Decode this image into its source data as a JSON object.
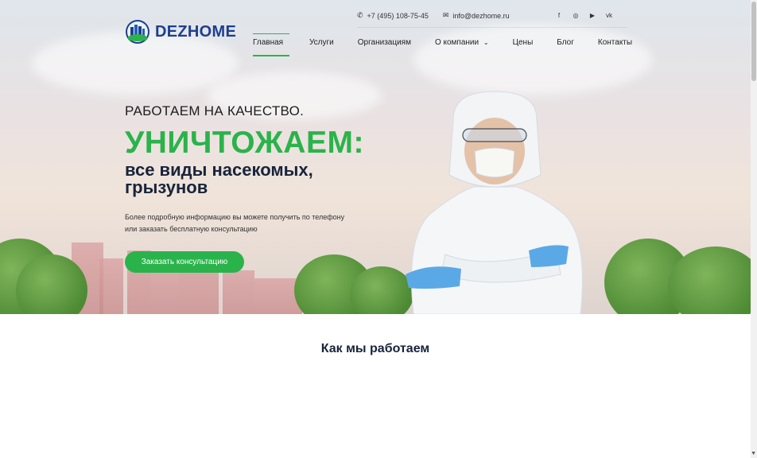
{
  "brand": {
    "name": "DEZHOME"
  },
  "contacts": {
    "phone": "+7 (495) 108-75-45",
    "email": "info@dezhome.ru"
  },
  "socials": [
    {
      "icon": "facebook-icon",
      "glyph": "f"
    },
    {
      "icon": "instagram-icon",
      "glyph": "◎"
    },
    {
      "icon": "youtube-icon",
      "glyph": "▶"
    },
    {
      "icon": "vk-icon",
      "glyph": "vk"
    }
  ],
  "nav": {
    "items": [
      {
        "label": "Главная",
        "active": true
      },
      {
        "label": "Услуги"
      },
      {
        "label": "Организациям"
      },
      {
        "label": "О компании",
        "dropdown": true
      },
      {
        "label": "Цены"
      },
      {
        "label": "Блог"
      },
      {
        "label": "Контакты"
      }
    ]
  },
  "hero": {
    "tagline": "РАБОТАЕМ НА КАЧЕСТВО.",
    "headline": "УНИЧТОЖАЕМ:",
    "subhead": "все виды насекомых, грызунов",
    "description": "Более подробную информацию вы можете получить по телефону или заказать бесплатную консультацию",
    "cta": "Заказать консультацию"
  },
  "section": {
    "title": "Как мы работаем"
  },
  "colors": {
    "accent": "#2bb34b",
    "dark": "#17243b",
    "brand": "#1e3f8f"
  }
}
